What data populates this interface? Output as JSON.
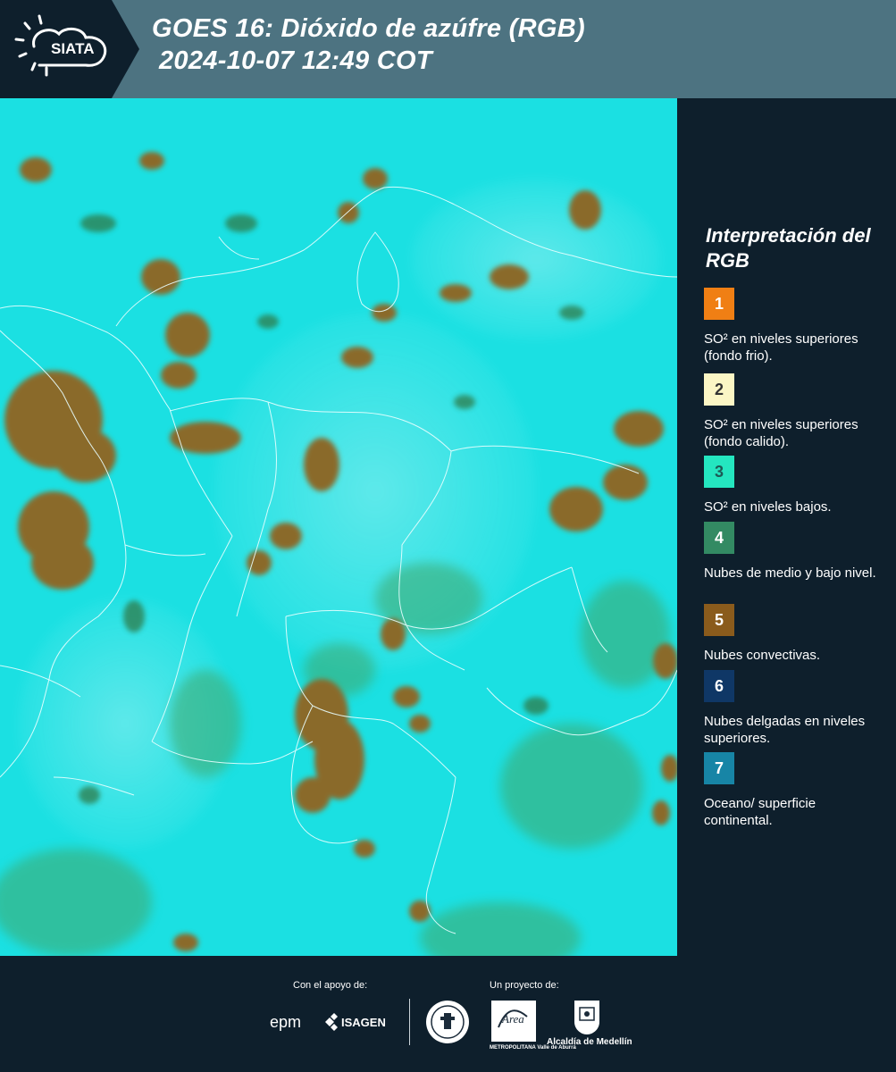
{
  "header": {
    "logo_text": "SIATA",
    "title_line1": "GOES 16: Dióxido de azúfre (RGB)",
    "title_line2": "2024-10-07 12:49 COT"
  },
  "legend": {
    "title": "Interpretación del RGB",
    "items": [
      {
        "number": "1",
        "label": "SO² en niveles superiores (fondo frio).",
        "color": "#f07f14",
        "text_color": "#ffffff"
      },
      {
        "number": "2",
        "label": "SO² en niveles superiores (fondo calido).",
        "color": "#fbf6c5",
        "text_color": "#333333"
      },
      {
        "number": "3",
        "label": "SO² en niveles bajos.",
        "color": "#24e6c0",
        "text_color": "#1d5a55"
      },
      {
        "number": "4",
        "label": "Nubes de medio y bajo nivel.",
        "color": "#338a63",
        "text_color": "#ffffff"
      },
      {
        "number": "5",
        "label": "Nubes convectivas.",
        "color": "#8a5b1c",
        "text_color": "#ffffff"
      },
      {
        "number": "6",
        "label": "Nubes delgadas en niveles superiores.",
        "color": "#0f3766",
        "text_color": "#ffffff"
      },
      {
        "number": "7",
        "label": "Oceano/ superficie continental.",
        "color": "#1785a6",
        "text_color": "#ffffff"
      }
    ]
  },
  "footer": {
    "support_label": "Con el apoyo de:",
    "project_label": "Un proyecto de:",
    "sponsors": [
      "epm",
      "ISAGEN"
    ],
    "partners": [
      "METROPOLITANA Valle de Aburrá",
      "Alcaldía de Medellín"
    ]
  }
}
